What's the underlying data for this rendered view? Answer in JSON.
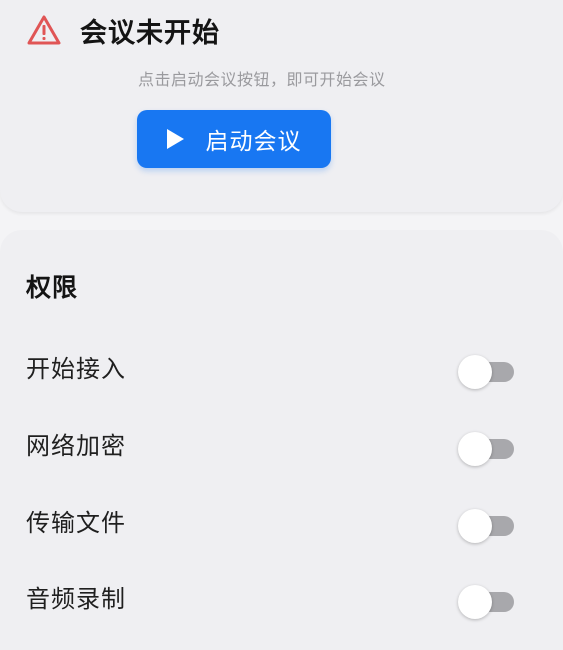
{
  "meeting_status": {
    "title": "会议未开始",
    "hint": "点击启动会议按钮，即可开始会议",
    "start_button_label": "启动会议",
    "warning_icon": "warning-triangle-icon",
    "play_icon": "play-icon",
    "accent_color": "#1877f2",
    "warning_color": "#e05555"
  },
  "permissions": {
    "title": "权限",
    "items": [
      {
        "label": "开始接入",
        "enabled": false
      },
      {
        "label": "网络加密",
        "enabled": false
      },
      {
        "label": "传输文件",
        "enabled": false
      },
      {
        "label": "音频录制",
        "enabled": false
      }
    ]
  }
}
